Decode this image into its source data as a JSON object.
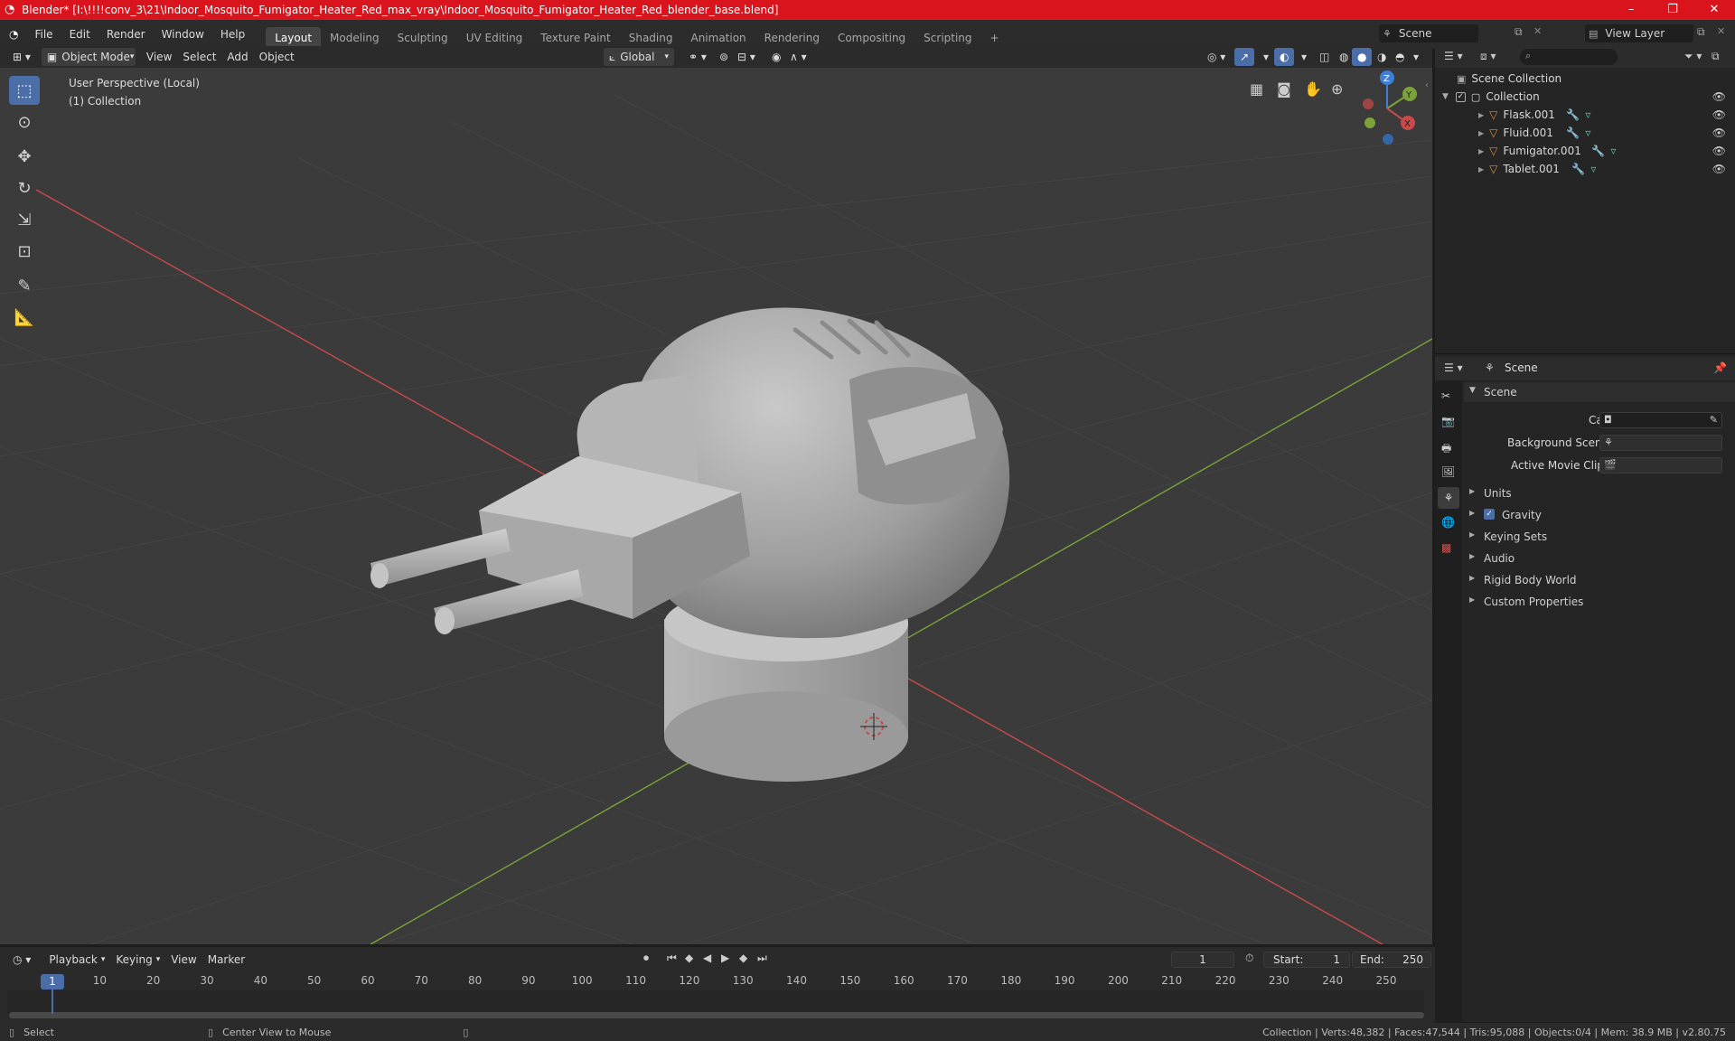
{
  "window": {
    "title": "Blender* [I:\\!!!!conv_3\\21\\Indoor_Mosquito_Fumigator_Heater_Red_max_vray\\Indoor_Mosquito_Fumigator_Heater_Red_blender_base.blend]",
    "minimize": "–",
    "maximize": "❐",
    "close": "✕"
  },
  "menu": [
    "File",
    "Edit",
    "Render",
    "Window",
    "Help"
  ],
  "workspaces": [
    "Layout",
    "Modeling",
    "Sculpting",
    "UV Editing",
    "Texture Paint",
    "Shading",
    "Animation",
    "Rendering",
    "Compositing",
    "Scripting",
    "+"
  ],
  "scene_selector": "Scene",
  "view_layer": "View Layer",
  "viewport_header": {
    "mode": "Object Mode",
    "view": "View",
    "select": "Select",
    "add": "Add",
    "object": "Object",
    "orientation": "Global"
  },
  "viewport": {
    "perspective": "User Perspective (Local)",
    "collection": "(1) Collection",
    "gizmo": {
      "z": "Z",
      "y": "Y",
      "x": "X"
    }
  },
  "outliner": {
    "root": "Scene Collection",
    "collection": "Collection",
    "items": [
      "Flask.001",
      "Fluid.001",
      "Fumigator.001",
      "Tablet.001"
    ]
  },
  "properties": {
    "context": "Scene",
    "panel": "Scene",
    "camera_label": "Camera",
    "bg_scene_label": "Background Scene",
    "movie_clip_label": "Active Movie Clip",
    "sections": [
      "Units",
      "Gravity",
      "Keying Sets",
      "Audio",
      "Rigid Body World",
      "Custom Properties"
    ]
  },
  "timeline": {
    "playback": "Playback",
    "keying": "Keying",
    "view": "View",
    "marker": "Marker",
    "current_frame": "1",
    "start_label": "Start:",
    "start": "1",
    "end_label": "End:",
    "end": "250",
    "ruler": [
      "1",
      "10",
      "20",
      "30",
      "40",
      "50",
      "60",
      "70",
      "80",
      "90",
      "100",
      "110",
      "120",
      "130",
      "140",
      "150",
      "160",
      "170",
      "180",
      "190",
      "200",
      "210",
      "220",
      "230",
      "240",
      "250"
    ]
  },
  "status": {
    "select": "Select",
    "center": "Center View to Mouse",
    "stats": "Collection | Verts:48,382 | Faces:47,544 | Tris:95,088 | Objects:0/4 | Mem: 38.9 MB | v2.80.75"
  },
  "colors": {
    "titlebar": "#d9141c",
    "accent": "#4b6ea8",
    "x_axis": "#c84a4a",
    "y_axis": "#7ba33a",
    "z_axis": "#3d7fd9"
  }
}
